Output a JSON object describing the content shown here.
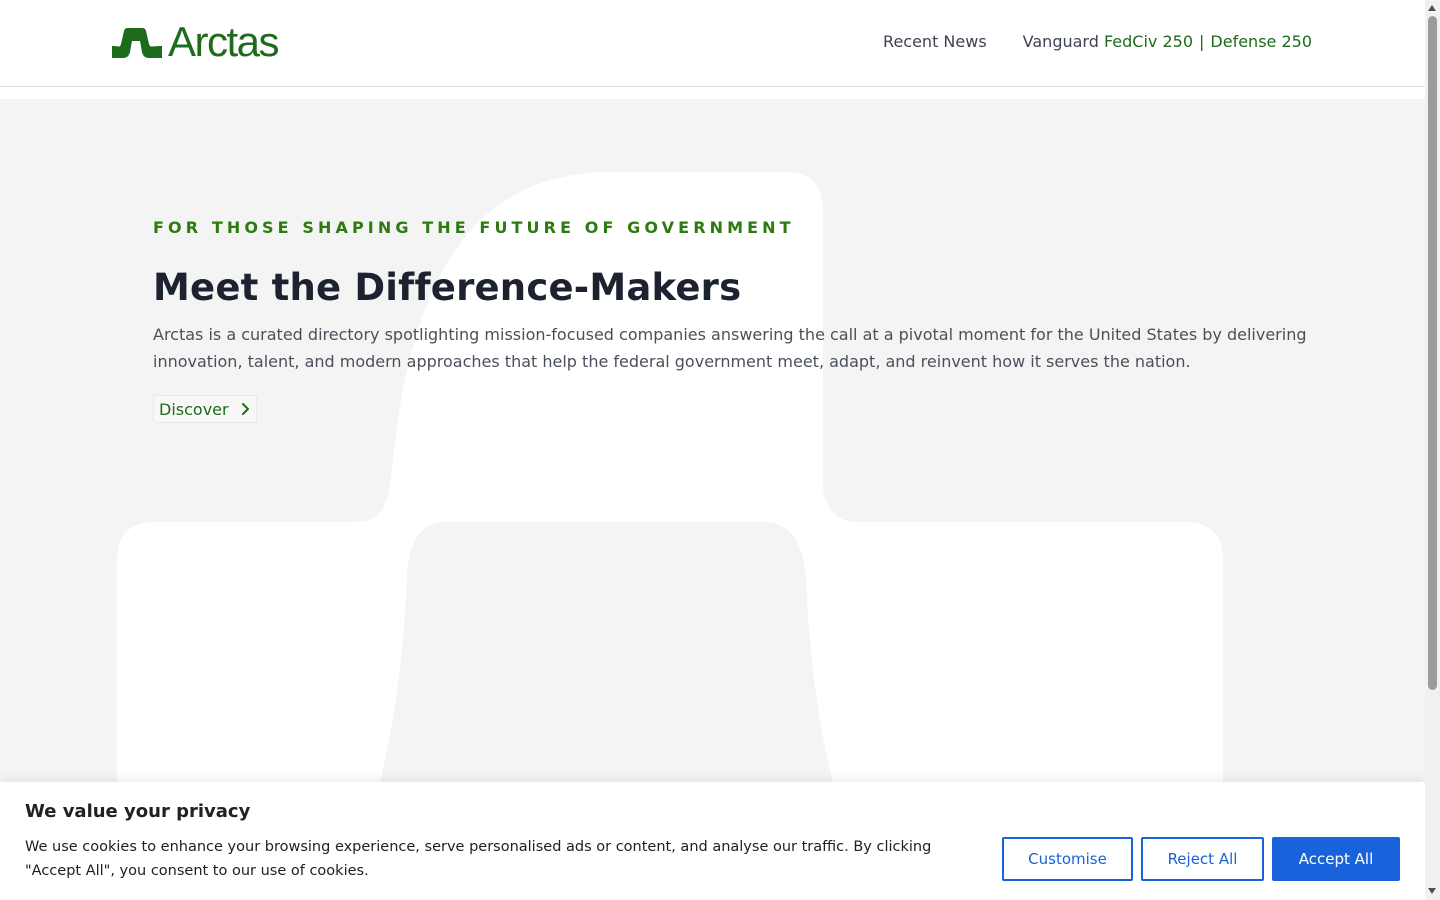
{
  "header": {
    "logo_text": "Arctas",
    "nav": {
      "recent_news": "Recent News",
      "vanguard_label": "Vanguard",
      "fedciv": "FedCiv 250",
      "separator": "|",
      "defense": "Defense 250"
    }
  },
  "hero": {
    "eyebrow": "FOR THOSE SHAPING THE FUTURE OF GOVERNMENT",
    "title": "Meet the Difference-Makers",
    "description": "Arctas is a curated directory spotlighting mission-focused companies answering the call at a pivotal moment for the United States by delivering innovation, talent, and modern approaches that help the federal government meet, adapt, and reinvent how it serves the nation.",
    "discover_label": "Discover"
  },
  "cookie_banner": {
    "title": "We value your privacy",
    "text": "We use cookies to enhance your browsing experience, serve personalised ads or content, and analyse our traffic. By clicking \"Accept All\", you consent to our use of cookies.",
    "customise_label": "Customise",
    "reject_label": "Reject All",
    "accept_label": "Accept All"
  },
  "icons": {
    "logo": "arctas-logo-icon",
    "discover": "chevron-right-icon",
    "scroll_up": "scroll-up-arrow-icon",
    "scroll_down": "scroll-down-arrow-icon"
  },
  "colors": {
    "brand_green": "#1f6b1c",
    "eyebrow_green": "#2d7a0e",
    "hero_bg": "#f4f4f4",
    "cookie_blue": "#1863dc",
    "text_dark": "#1c2230"
  }
}
